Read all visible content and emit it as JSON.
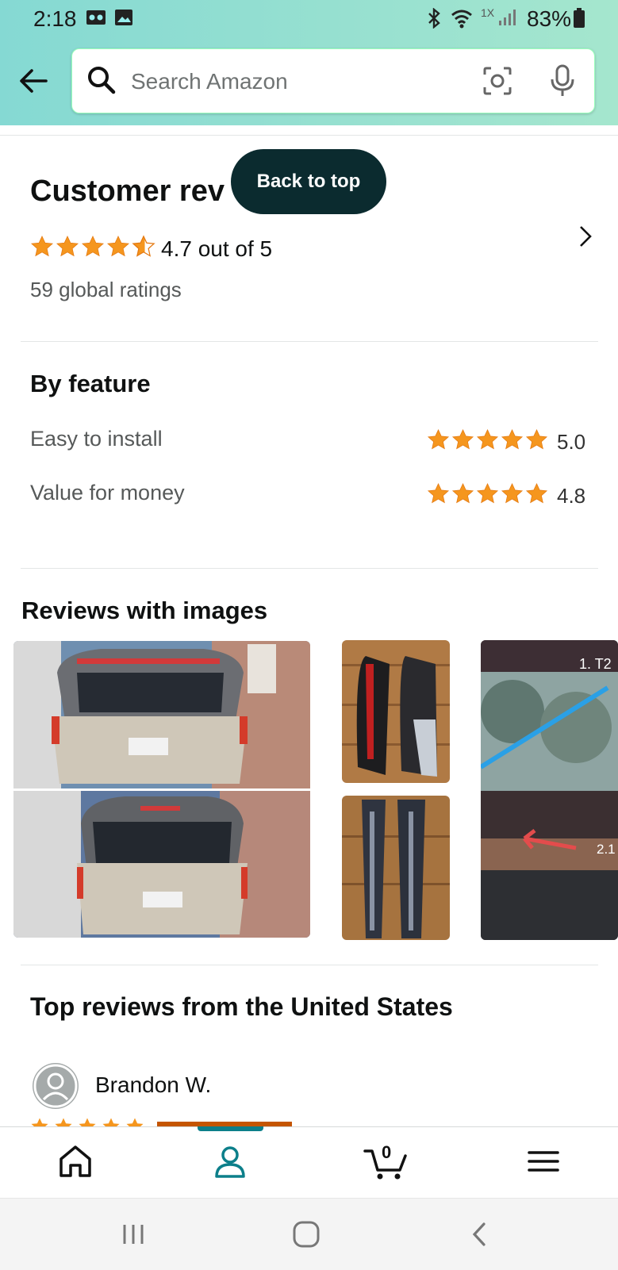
{
  "status_bar": {
    "time": "2:18",
    "network_label": "1X",
    "battery": "83%",
    "icons": [
      "voicemail-icon",
      "gallery-icon",
      "bluetooth-icon",
      "wifi-icon",
      "signal-icon",
      "battery-icon"
    ]
  },
  "header": {
    "search_placeholder": "Search Amazon",
    "icons": [
      "back-arrow-icon",
      "search-icon",
      "camera-scan-icon",
      "microphone-icon"
    ]
  },
  "back_to_top_label": "Back to top",
  "customer_reviews": {
    "title": "Customer rev",
    "rating": 4.7,
    "rating_text": "4.7 out of 5",
    "global_ratings": "59 global ratings"
  },
  "by_feature": {
    "title": "By feature",
    "items": [
      {
        "label": "Easy to install",
        "value": "5.0",
        "stars": 5
      },
      {
        "label": "Value for money",
        "value": "4.8",
        "stars": 5
      }
    ]
  },
  "reviews_with_images": {
    "title": "Reviews with images",
    "images": [
      "suv-rear-spoiler-light-photo",
      "spoiler-parts-on-table-photo",
      "spoiler-parts-underside-photo",
      "rear-window-annotated-photo"
    ],
    "visible_labels": [
      "1. T2",
      "2.1"
    ]
  },
  "top_reviews": {
    "title": "Top reviews from the United States",
    "reviewer": "Brandon W."
  },
  "bottom_nav": {
    "items": [
      "home-icon",
      "account-icon",
      "cart-icon",
      "menu-icon"
    ],
    "cart_count": "0",
    "active": "account"
  },
  "colors": {
    "header_gradient_start": "#85d9d3",
    "header_gradient_end": "#a5e6ce",
    "star": "#f5961e",
    "back_to_top_bg": "#0b2b2f",
    "active_nav": "#0c7f8a"
  }
}
